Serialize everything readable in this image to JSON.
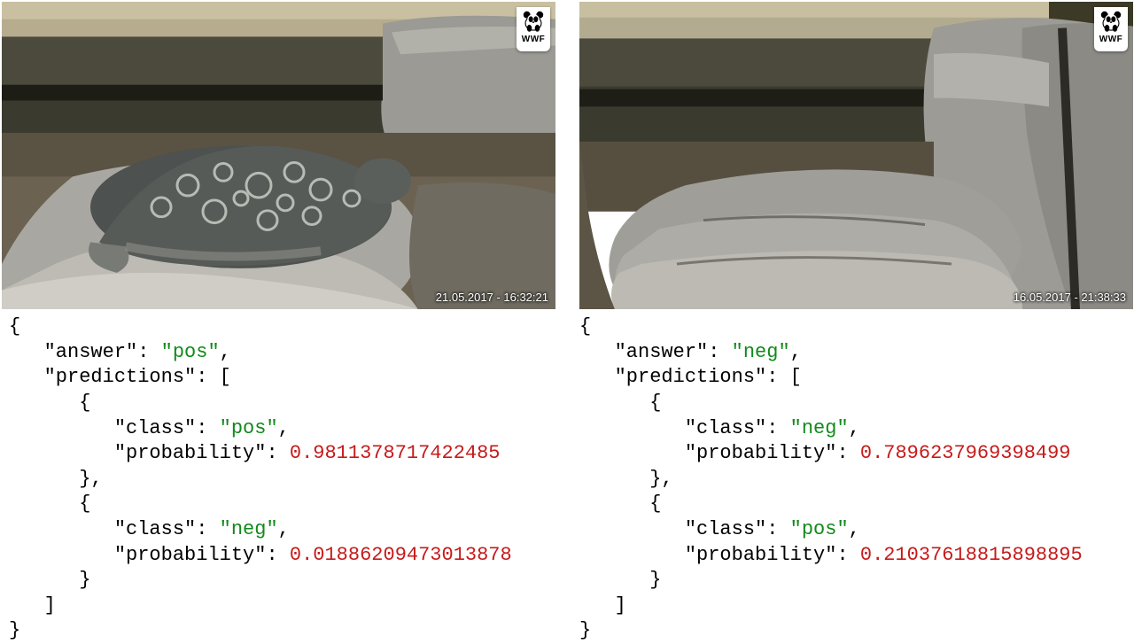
{
  "left": {
    "timestamp": "21.05.2017 - 16:32:21",
    "wwf": "WWF",
    "json": {
      "answer_key": "\"answer\"",
      "answer_val": "\"pos\"",
      "predictions_key": "\"predictions\"",
      "p0_class_key": "\"class\"",
      "p0_class_val": "\"pos\"",
      "p0_prob_key": "\"probability\"",
      "p0_prob_val": "0.9811378717422485",
      "p1_class_key": "\"class\"",
      "p1_class_val": "\"neg\"",
      "p1_prob_key": "\"probability\"",
      "p1_prob_val": "0.01886209473013878"
    }
  },
  "right": {
    "timestamp": "16.05.2017 - 21:38:33",
    "wwf": "WWF",
    "json": {
      "answer_key": "\"answer\"",
      "answer_val": "\"neg\"",
      "predictions_key": "\"predictions\"",
      "p0_class_key": "\"class\"",
      "p0_class_val": "\"neg\"",
      "p0_prob_key": "\"probability\"",
      "p0_prob_val": "0.7896237969398499",
      "p1_class_key": "\"class\"",
      "p1_class_val": "\"pos\"",
      "p1_prob_key": "\"probability\"",
      "p1_prob_val": "0.21037618815898895"
    }
  }
}
